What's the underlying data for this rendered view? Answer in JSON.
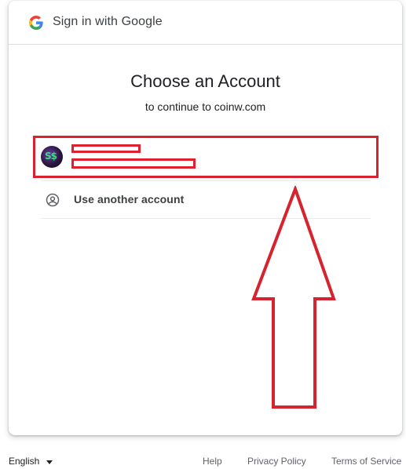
{
  "header": {
    "logo_icon": "google-g-icon",
    "title": "Sign in with Google"
  },
  "main": {
    "title": "Choose an Account",
    "subtitle": "to continue to coinw.com"
  },
  "account": {
    "avatar_icon": "user-avatar-icon",
    "avatar_text": "S$",
    "name_redacted": true,
    "email_redacted": true
  },
  "other_account": {
    "icon": "person-circle-icon",
    "label": "Use another account"
  },
  "annotation": {
    "highlight_color": "#d6232d",
    "arrow_direction": "up"
  },
  "footer": {
    "language": "English",
    "help": "Help",
    "privacy": "Privacy Policy",
    "terms": "Terms of Service"
  },
  "colors": {
    "google_blue": "#4285F4",
    "google_red": "#EA4335",
    "google_yellow": "#FBBC05",
    "google_green": "#34A853"
  }
}
